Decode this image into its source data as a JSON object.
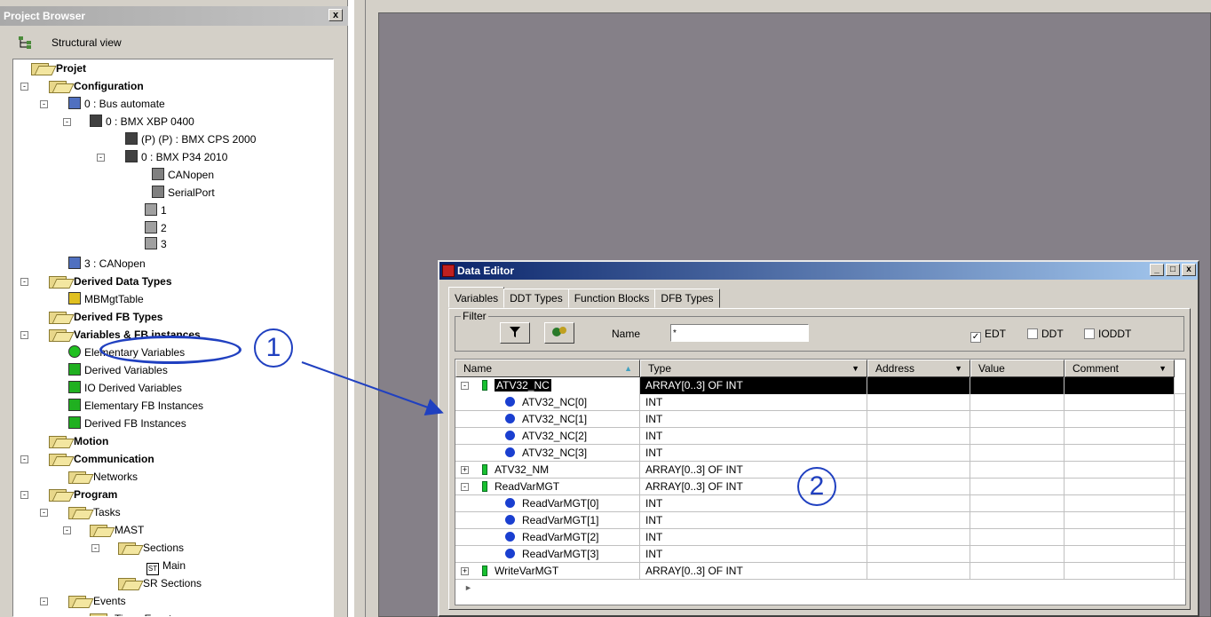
{
  "project_browser": {
    "title": "Project Browser",
    "close_glyph": "x",
    "view_label": "Structural view",
    "tree": [
      {
        "label": "Projet",
        "bold": true
      },
      {
        "label": "Configuration",
        "bold": true
      },
      {
        "label": "0 : Bus automate",
        "bold": false
      },
      {
        "label": "0 : BMX XBP 0400",
        "bold": false
      },
      {
        "label": "(P) (P) : BMX CPS 2000",
        "bold": false
      },
      {
        "label": "0 : BMX P34 2010",
        "bold": false
      },
      {
        "label": "CANopen",
        "bold": false
      },
      {
        "label": "SerialPort",
        "bold": false
      },
      {
        "label": "1",
        "bold": false
      },
      {
        "label": "2",
        "bold": false
      },
      {
        "label": "3",
        "bold": false
      },
      {
        "label": "3 : CANopen",
        "bold": false
      },
      {
        "label": "Derived Data Types",
        "bold": true
      },
      {
        "label": "MBMgtTable",
        "bold": false
      },
      {
        "label": "Derived FB Types",
        "bold": true
      },
      {
        "label": "Variables & FB instances",
        "bold": true
      },
      {
        "label": "Elementary Variables",
        "bold": false
      },
      {
        "label": "Derived Variables",
        "bold": false
      },
      {
        "label": "IO Derived Variables",
        "bold": false
      },
      {
        "label": "Elementary FB Instances",
        "bold": false
      },
      {
        "label": "Derived FB Instances",
        "bold": false
      },
      {
        "label": "Motion",
        "bold": true
      },
      {
        "label": "Communication",
        "bold": true
      },
      {
        "label": "Networks",
        "bold": false
      },
      {
        "label": "Program",
        "bold": true
      },
      {
        "label": "Tasks",
        "bold": false
      },
      {
        "label": "MAST",
        "bold": false
      },
      {
        "label": "Sections",
        "bold": false
      },
      {
        "label": "Main",
        "bold": false
      },
      {
        "label": "SR Sections",
        "bold": false
      },
      {
        "label": "Events",
        "bold": false
      },
      {
        "label": "Timer Events",
        "bold": false
      }
    ]
  },
  "data_editor": {
    "title": "Data Editor",
    "tabs": [
      "Variables",
      "DDT Types",
      "Function Blocks",
      "DFB Types"
    ],
    "filter": {
      "legend": "Filter",
      "name_label": "Name",
      "name_value": "*",
      "checks": [
        {
          "label": "EDT",
          "checked": true
        },
        {
          "label": "DDT",
          "checked": false
        },
        {
          "label": "IODDT",
          "checked": false
        }
      ]
    },
    "columns": [
      "Name",
      "Type",
      "Address",
      "Value",
      "Comment"
    ],
    "rows": [
      {
        "name": "ATV32_NC",
        "type": "ARRAY[0..3] OF INT",
        "level": 0,
        "expander": "-",
        "selected": true
      },
      {
        "name": "ATV32_NC[0]",
        "type": "INT",
        "level": 1
      },
      {
        "name": "ATV32_NC[1]",
        "type": "INT",
        "level": 1
      },
      {
        "name": "ATV32_NC[2]",
        "type": "INT",
        "level": 1
      },
      {
        "name": "ATV32_NC[3]",
        "type": "INT",
        "level": 1
      },
      {
        "name": "ATV32_NM",
        "type": "ARRAY[0..3] OF INT",
        "level": 0,
        "expander": "+"
      },
      {
        "name": "ReadVarMGT",
        "type": "ARRAY[0..3] OF INT",
        "level": 0,
        "expander": "-"
      },
      {
        "name": "ReadVarMGT[0]",
        "type": "INT",
        "level": 1
      },
      {
        "name": "ReadVarMGT[1]",
        "type": "INT",
        "level": 1
      },
      {
        "name": "ReadVarMGT[2]",
        "type": "INT",
        "level": 1
      },
      {
        "name": "ReadVarMGT[3]",
        "type": "INT",
        "level": 1
      },
      {
        "name": "WriteVarMGT",
        "type": "ARRAY[0..3] OF INT",
        "level": 0,
        "expander": "+"
      }
    ]
  },
  "callouts": [
    "1",
    "2"
  ],
  "colors": {
    "accent": "#2040c0",
    "titlebar": "#0a246a",
    "mdi_background": "#858088"
  }
}
